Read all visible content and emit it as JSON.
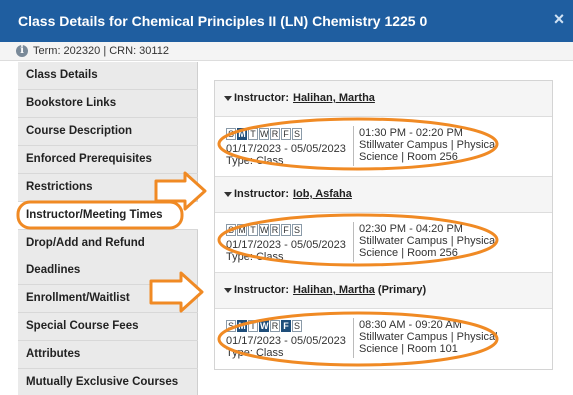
{
  "window": {
    "title": "Class Details for Chemical Principles II (LN) Chemistry 1225 0",
    "close_icon": "close-icon"
  },
  "term_bar": {
    "text": "Term: 202320 | CRN: 30112",
    "info_icon": "info-icon"
  },
  "sidebar": {
    "items": [
      {
        "label": "Class Details"
      },
      {
        "label": "Bookstore Links"
      },
      {
        "label": "Course Description"
      },
      {
        "label": "Enforced Prerequisites"
      },
      {
        "label": "Restrictions"
      },
      {
        "label": "Instructor/Meeting Times",
        "active": true
      },
      {
        "label": "Drop/Add and Refund"
      },
      {
        "label": "Deadlines"
      },
      {
        "label": "Enrollment/Waitlist"
      },
      {
        "label": "Special Course Fees"
      },
      {
        "label": "Attributes"
      },
      {
        "label": "Mutually Exclusive Courses"
      }
    ]
  },
  "instructors": [
    {
      "label": "Instructor:",
      "name": "Halihan, Martha",
      "suffix": "",
      "meeting": {
        "days": [
          "S",
          "M",
          "T",
          "W",
          "R",
          "F",
          "S"
        ],
        "active_days": [
          false,
          true,
          false,
          false,
          false,
          false,
          false
        ],
        "dates": "01/17/2023 - 05/05/2023",
        "type": "Type: Class",
        "time": "01:30 PM - 02:20 PM",
        "location_line1": "Stillwater Campus | Physical",
        "location_line2": "Science | Room 256"
      }
    },
    {
      "label": "Instructor:",
      "name": "Iob, Asfaha",
      "suffix": "",
      "meeting": {
        "days": [
          "S",
          "M",
          "T",
          "W",
          "R",
          "F",
          "S"
        ],
        "active_days": [
          false,
          false,
          false,
          false,
          false,
          false,
          false
        ],
        "dates": "01/17/2023 - 05/05/2023",
        "type": "Type: Class",
        "time": "02:30 PM - 04:20 PM",
        "location_line1": "Stillwater Campus | Physical",
        "location_line2": "Science | Room 256"
      }
    },
    {
      "label": "Instructor:",
      "name": "Halihan, Martha",
      "suffix": "(Primary)",
      "meeting": {
        "days": [
          "S",
          "M",
          "T",
          "W",
          "R",
          "F",
          "S"
        ],
        "active_days": [
          false,
          true,
          false,
          true,
          false,
          true,
          false
        ],
        "dates": "01/17/2023 - 05/05/2023",
        "type": "Type: Class",
        "time": "08:30 AM - 09:20 AM",
        "location_line1": "Stillwater Campus | Physical",
        "location_line2": "Science | Room 101"
      }
    }
  ],
  "colors": {
    "header_bg": "#1f5ea0",
    "active_day": "#1f4e7a",
    "highlight": "#f08a24"
  }
}
